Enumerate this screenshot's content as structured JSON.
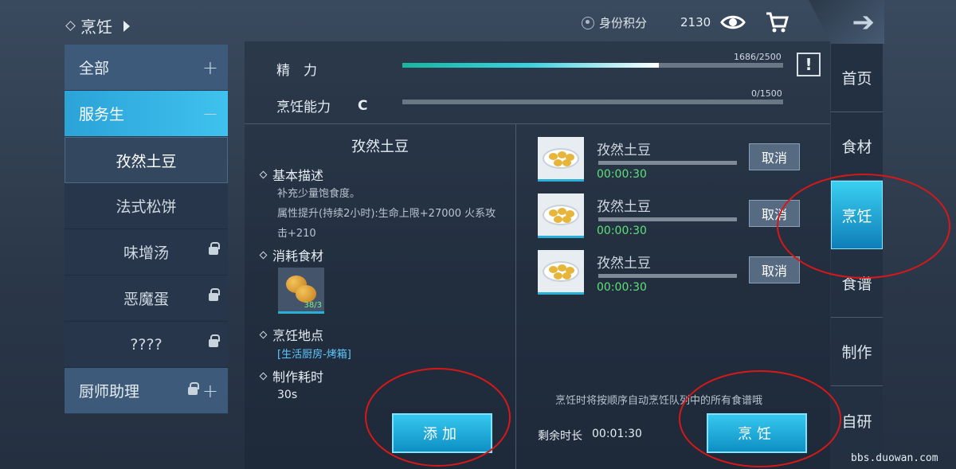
{
  "header": {
    "title": "烹饪",
    "score_label": "身份积分",
    "score_value": "2130"
  },
  "icons": {
    "eye": "eye-icon",
    "cart": "cart-icon",
    "back": "arrow-right-icon"
  },
  "categories": [
    {
      "label": "全部",
      "sign": "+"
    },
    {
      "label": "服务生",
      "sign": "−"
    },
    {
      "label": "厨师助理",
      "sign": "+"
    }
  ],
  "recipes": [
    {
      "label": "孜然土豆"
    },
    {
      "label": "法式松饼"
    },
    {
      "label": "味增汤"
    },
    {
      "label": "恶魔蛋"
    },
    {
      "label": "????"
    }
  ],
  "stats": {
    "energy_label": "精　力",
    "energy_value": "1686/2500",
    "energy_fraction": 0.6744,
    "cooking_label": "烹饪能力",
    "cooking_grade": "C",
    "cooking_value": "0/1500",
    "cooking_fraction": 0.0,
    "warn_label": "!"
  },
  "detail": {
    "title": "孜然土豆",
    "desc_heading": "基本描述",
    "desc_line1": "补充少量饱食度。",
    "desc_line2": "属性提升(持续2小时):生命上限+27000 火系攻击+210",
    "ingredients_heading": "消耗食材",
    "ingredient_count": "38/3",
    "place_heading": "烹饪地点",
    "place_value": "[生活厨房-烤箱]",
    "time_heading": "制作耗时",
    "time_value": "30s",
    "add_button": "添加"
  },
  "queue": [
    {
      "name": "孜然土豆",
      "time": "00:00:30",
      "cancel": "取消"
    },
    {
      "name": "孜然土豆",
      "time": "00:00:30",
      "cancel": "取消"
    },
    {
      "name": "孜然土豆",
      "time": "00:00:30",
      "cancel": "取消"
    }
  ],
  "queue_footer": {
    "hint": "烹饪时将按顺序自动烹饪队列中的所有食谱哦",
    "remain_label": "剩余时长",
    "remain_value": "00:01:30",
    "cook_button": "烹饪"
  },
  "right_nav": [
    "首页",
    "食材",
    "烹饪",
    "食谱",
    "制作",
    "自研"
  ],
  "watermark": "bbs.duowan.com",
  "colors": {
    "accent": "#2ba3d8",
    "annotation": "#d81818",
    "timer": "#5fe07a"
  }
}
